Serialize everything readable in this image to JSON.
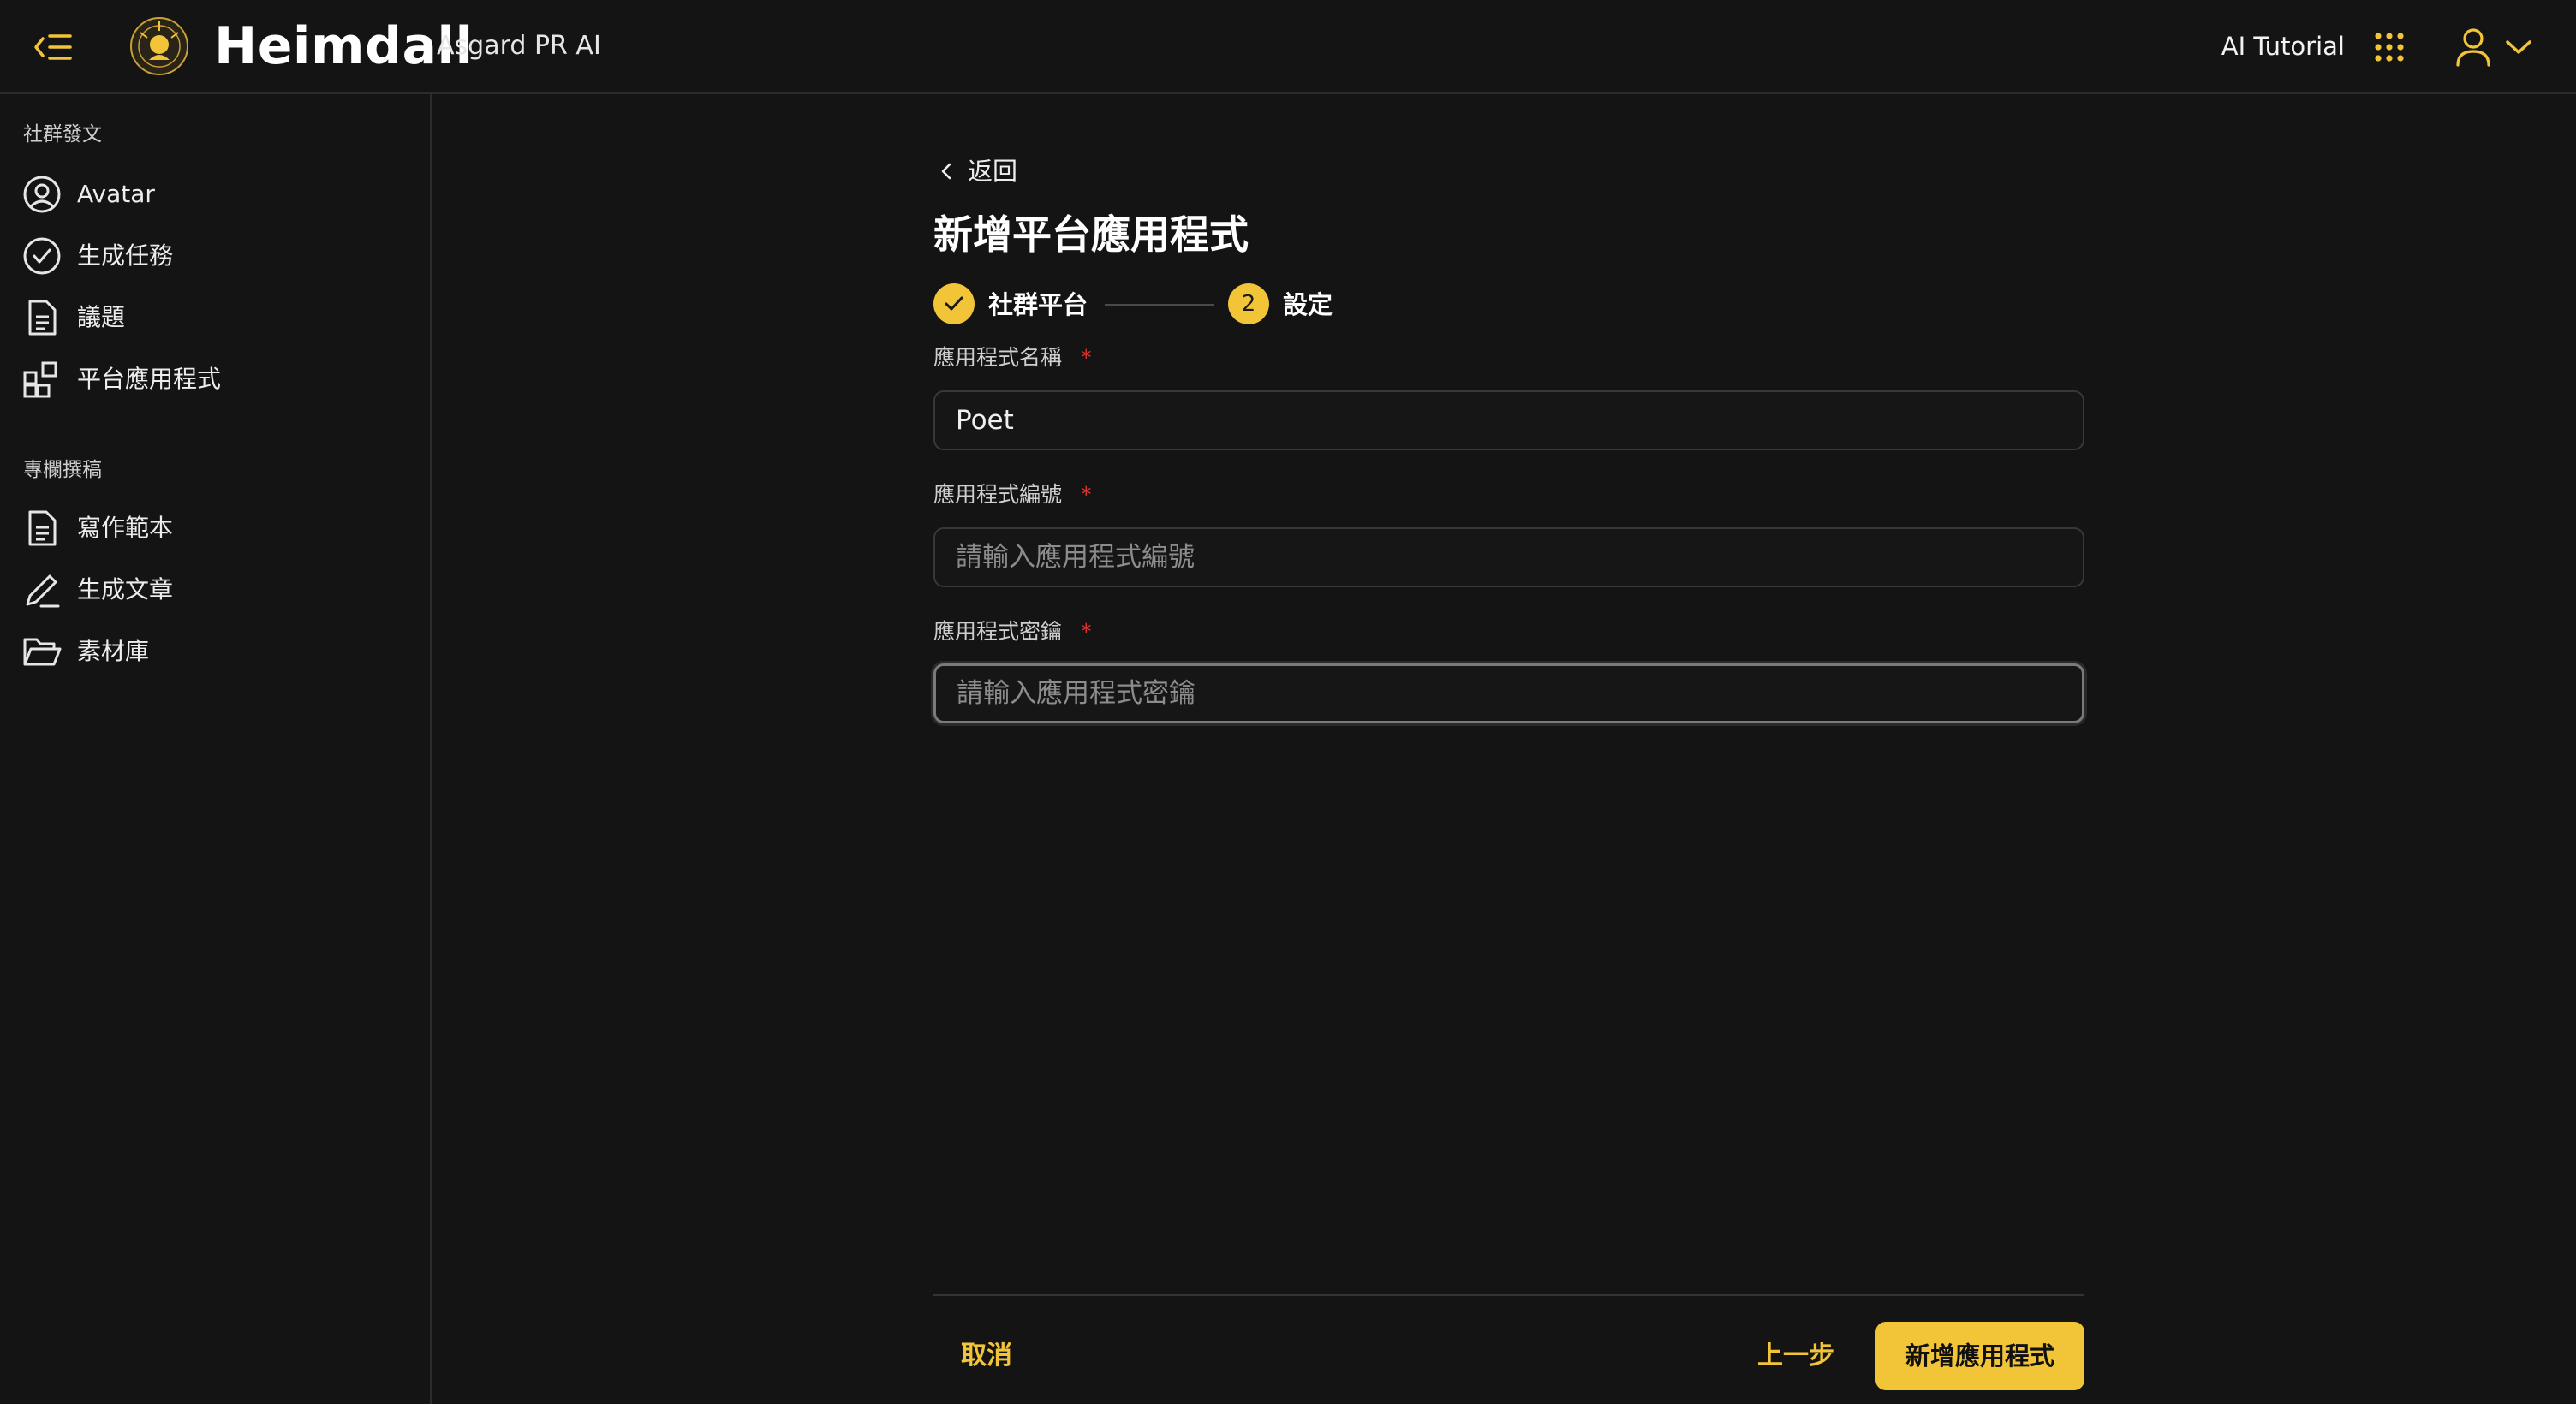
{
  "header": {
    "brand": "Heimdall",
    "brand_sub": "Asgard PR AI",
    "tutorial_link": "AI Tutorial"
  },
  "sidebar": {
    "sections": [
      {
        "title": "社群發文",
        "items": [
          {
            "label": "Avatar",
            "icon": "user-circle-icon"
          },
          {
            "label": "生成任務",
            "icon": "check-circle-icon"
          },
          {
            "label": "議題",
            "icon": "document-icon"
          },
          {
            "label": "平台應用程式",
            "icon": "apps-grid-icon"
          }
        ]
      },
      {
        "title": "專欄撰稿",
        "items": [
          {
            "label": "寫作範本",
            "icon": "document-icon"
          },
          {
            "label": "生成文章",
            "icon": "pencil-icon"
          },
          {
            "label": "素材庫",
            "icon": "folder-icon"
          }
        ]
      }
    ]
  },
  "main": {
    "back_label": "返回",
    "page_title": "新增平台應用程式",
    "steps": [
      {
        "label": "社群平台",
        "status": "completed"
      },
      {
        "label": "設定",
        "number": "2",
        "status": "current"
      }
    ],
    "form": {
      "fields": [
        {
          "label": "應用程式名稱",
          "required_mark": "*",
          "value": "Poet",
          "placeholder": ""
        },
        {
          "label": "應用程式編號",
          "required_mark": "*",
          "value": "",
          "placeholder": "請輸入應用程式編號"
        },
        {
          "label": "應用程式密鑰",
          "required_mark": "*",
          "value": "",
          "placeholder": "請輸入應用程式密鑰"
        }
      ]
    },
    "footer": {
      "cancel": "取消",
      "prev": "上一步",
      "submit": "新增應用程式"
    }
  },
  "colors": {
    "background": "#141414",
    "accent": "#f2c437",
    "required": "#e03131"
  }
}
